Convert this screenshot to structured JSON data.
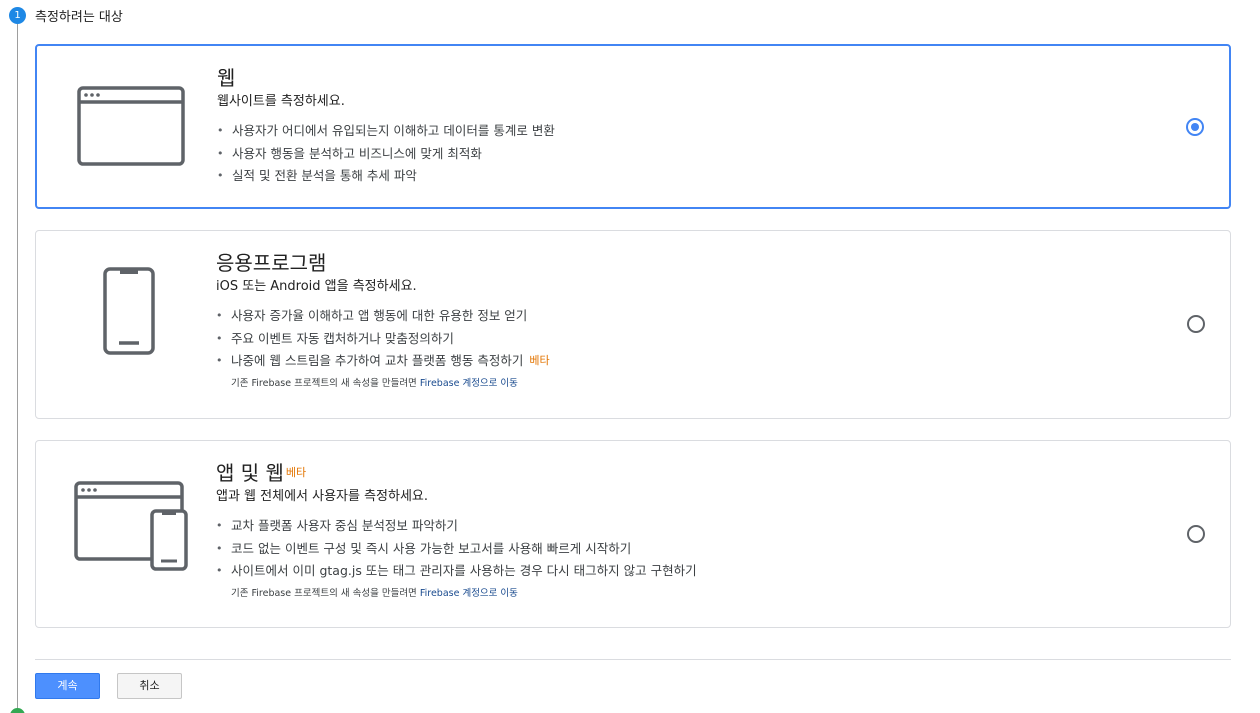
{
  "step": {
    "number": "1",
    "title": "측정하려는 대상"
  },
  "options": [
    {
      "id": "web",
      "title": "웹",
      "subtitle": "웹사이트를 측정하세요.",
      "bullets": [
        "사용자가 어디에서 유입되는지 이해하고 데이터를 통계로 변환",
        "사용자 행동을 분석하고 비즈니스에 맞게 최적화",
        "실적 및 전환 분석을 통해 추세 파악"
      ],
      "selected": true,
      "icon": "browser-window-icon"
    },
    {
      "id": "app",
      "title": "응용프로그램",
      "subtitle": "iOS 또는 Android 앱을 측정하세요.",
      "bullets": [
        "사용자 증가율 이해하고 앱 행동에 대한 유용한 정보 얻기",
        "주요 이벤트 자동 캡처하거나 맞춤정의하기",
        "나중에 웹 스트림을 추가하여 교차 플랫폼 행동 측정하기"
      ],
      "bullet_beta": "베타",
      "note_prefix": "기존 Firebase 프로젝트의 새 속성을 만들려면 ",
      "note_link": "Firebase 계정으로 이동",
      "selected": false,
      "icon": "smartphone-icon"
    },
    {
      "id": "appweb",
      "title": "앱 및 웹",
      "title_beta": "베타",
      "subtitle": "앱과 웹 전체에서 사용자를 측정하세요.",
      "bullets": [
        "교차 플랫폼 사용자 중심 분석정보 파악하기",
        "코드 없는 이벤트 구성 및 즉시 사용 가능한 보고서를 사용해 빠르게 시작하기",
        "사이트에서 이미 gtag.js 또는 태그 관리자를 사용하는 경우 다시 태그하지 않고 구현하기"
      ],
      "note_prefix": "기존 Firebase 프로젝트의 새 속성을 만들려면 ",
      "note_link": "Firebase 계정으로 이동",
      "selected": false,
      "icon": "browser-and-phone-icon"
    }
  ],
  "actions": {
    "continue_label": "계속",
    "cancel_label": "취소"
  },
  "colors": {
    "accent": "#4285f4",
    "primary_button": "#4d90fe",
    "beta": "#e37400",
    "link": "#1a4b8f",
    "step_badge": "#1e88e5"
  }
}
